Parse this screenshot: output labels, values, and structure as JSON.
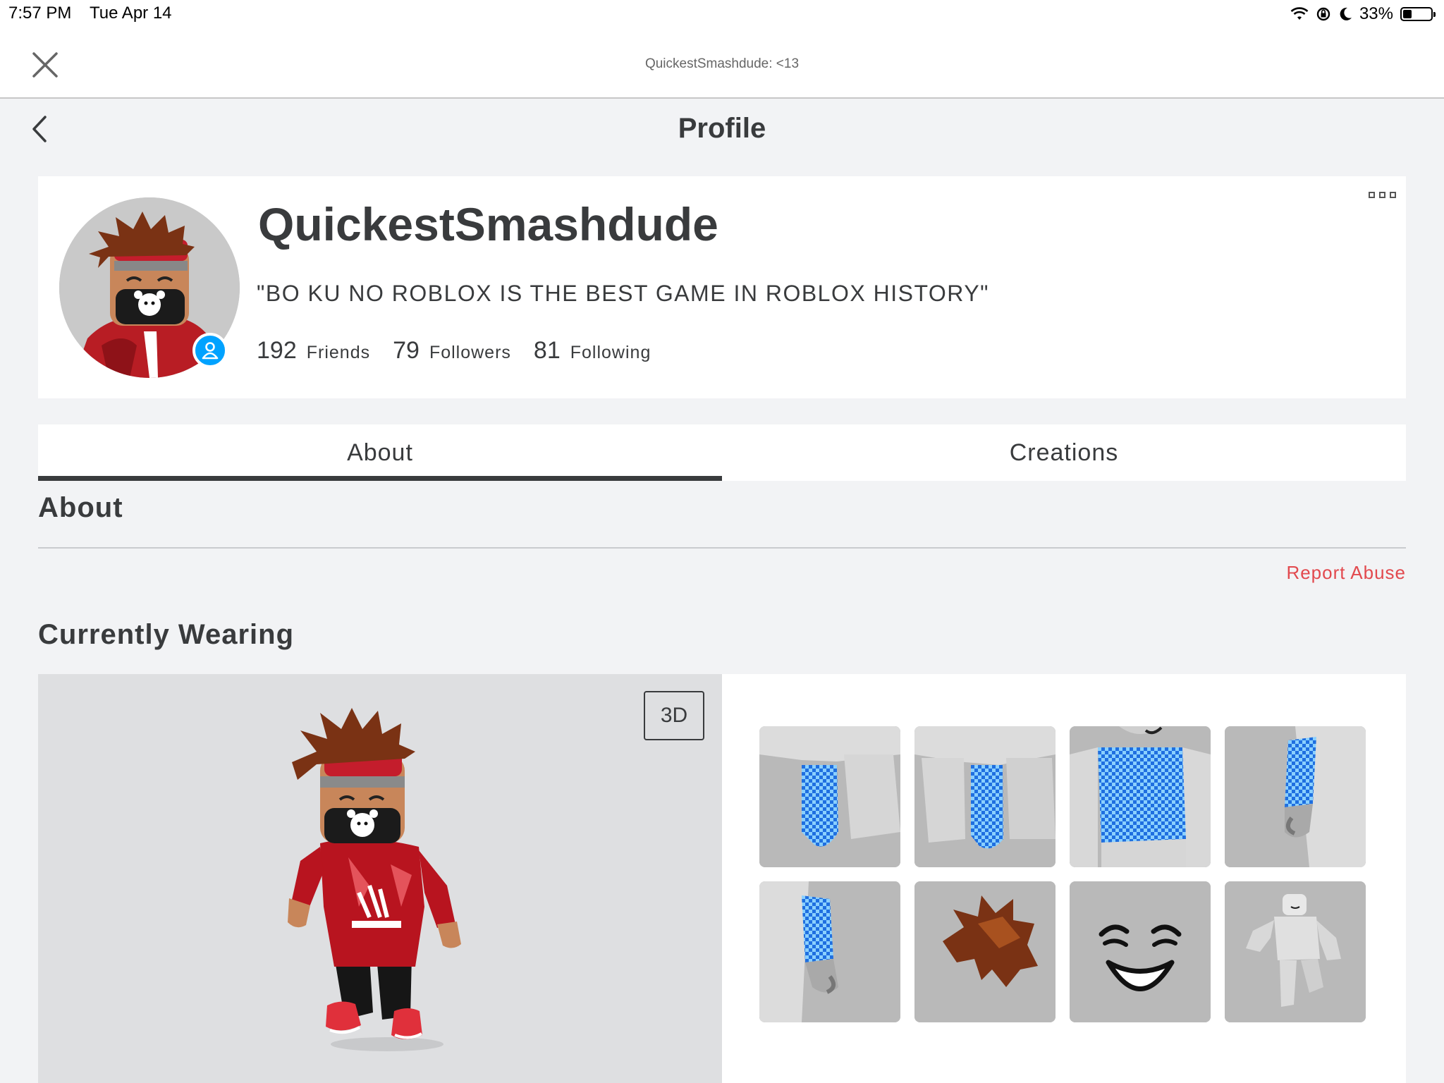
{
  "status_bar": {
    "time": "7:57 PM",
    "date": "Tue Apr 14",
    "battery": "33%"
  },
  "top_bar": {
    "title": "QuickestSmashdude: <13"
  },
  "nav": {
    "page_title": "Profile"
  },
  "profile": {
    "username": "QuickestSmashdude",
    "status": "\"BO KU NO ROBLOX IS THE BEST GAME IN ROBLOX HISTORY\"",
    "stats": [
      {
        "count": "192",
        "label": "Friends"
      },
      {
        "count": "79",
        "label": "Followers"
      },
      {
        "count": "81",
        "label": "Following"
      }
    ]
  },
  "tabs": [
    {
      "label": "About",
      "active": true
    },
    {
      "label": "Creations",
      "active": false
    }
  ],
  "about": {
    "heading": "About",
    "report_label": "Report Abuse"
  },
  "wearing": {
    "heading": "Currently Wearing",
    "view_toggle": "3D",
    "items": [
      {
        "icon": "left-leg-pants-icon"
      },
      {
        "icon": "right-leg-pants-icon"
      },
      {
        "icon": "torso-shirt-icon"
      },
      {
        "icon": "right-arm-shirt-icon"
      },
      {
        "icon": "left-arm-shirt-icon"
      },
      {
        "icon": "brown-hair-icon"
      },
      {
        "icon": "smile-face-icon"
      },
      {
        "icon": "body-package-icon"
      }
    ]
  },
  "colors": {
    "accent": "#00a2ff",
    "report": "#e2494e",
    "text": "#393b3d",
    "background": "#f2f3f5"
  }
}
